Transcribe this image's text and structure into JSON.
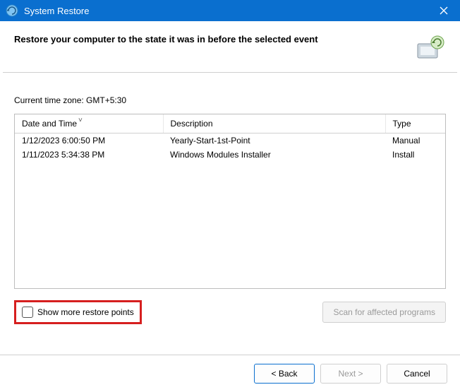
{
  "titlebar": {
    "title": "System Restore"
  },
  "header": {
    "heading": "Restore your computer to the state it was in before the selected event"
  },
  "content": {
    "timezone_label": "Current time zone: GMT+5:30",
    "table": {
      "columns": {
        "date": "Date and Time",
        "desc": "Description",
        "type": "Type"
      },
      "rows": [
        {
          "date": "1/12/2023 6:00:50 PM",
          "desc": "Yearly-Start-1st-Point",
          "type": "Manual"
        },
        {
          "date": "1/11/2023 5:34:38 PM",
          "desc": "Windows Modules Installer",
          "type": "Install"
        }
      ]
    },
    "show_more_label": "Show more restore points",
    "scan_button_label": "Scan for affected programs"
  },
  "footer": {
    "back": "< Back",
    "next": "Next >",
    "cancel": "Cancel"
  }
}
